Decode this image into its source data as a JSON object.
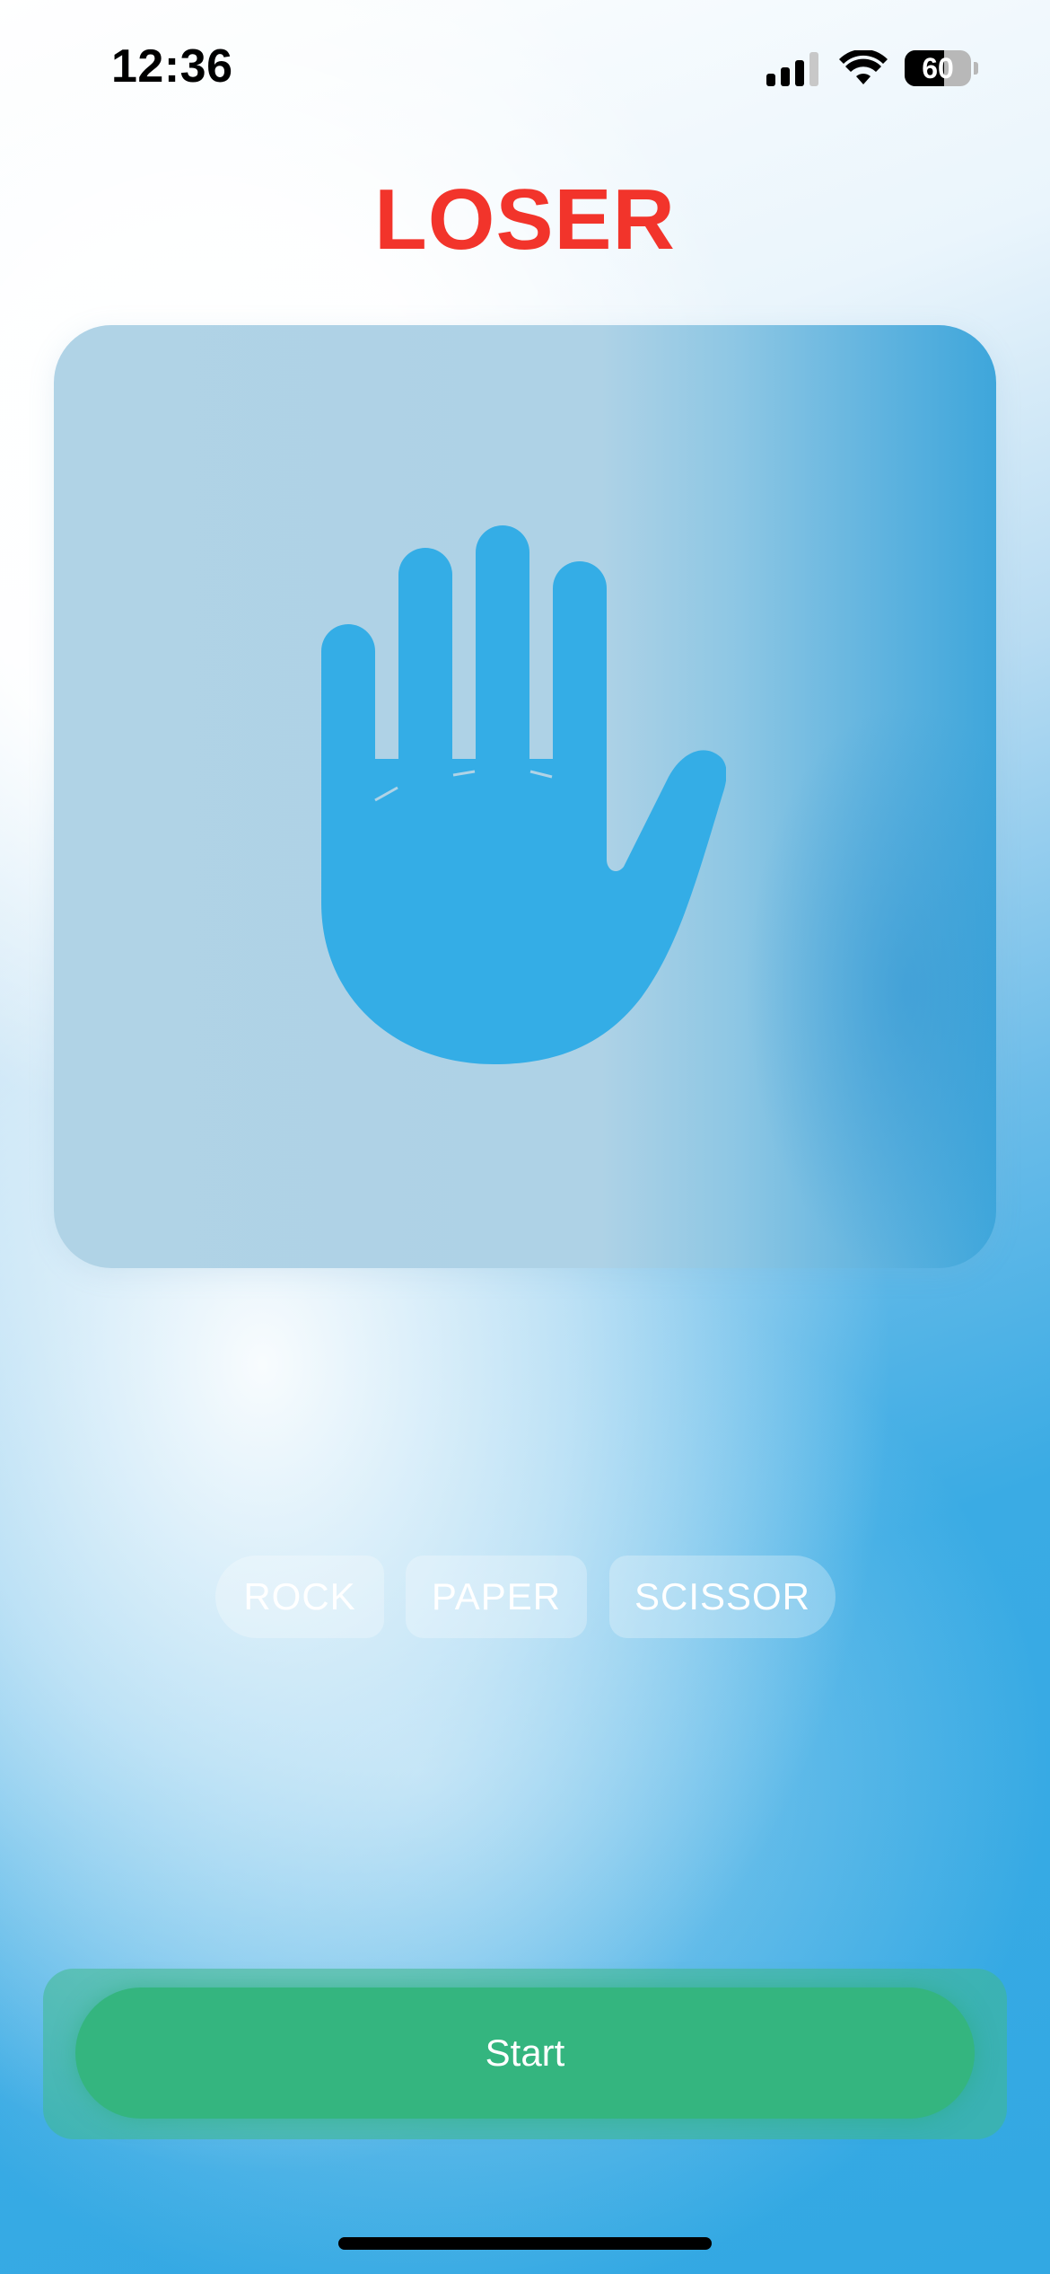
{
  "status_bar": {
    "time": "12:36",
    "battery_level": "60",
    "battery_percent": 60,
    "signal_bars": 3,
    "signal_icon": "cellular-signal-icon",
    "wifi_icon": "wifi-icon",
    "battery_icon": "battery-icon"
  },
  "game": {
    "result": "LOSER",
    "result_color": "#f2342b",
    "current_choice_icon": "hand-raised-icon",
    "icon_color": "#34ade6"
  },
  "choices": [
    {
      "label": "ROCK"
    },
    {
      "label": "PAPER"
    },
    {
      "label": "SCISSOR"
    }
  ],
  "actions": {
    "start_label": "Start",
    "start_color": "#34b57f"
  }
}
